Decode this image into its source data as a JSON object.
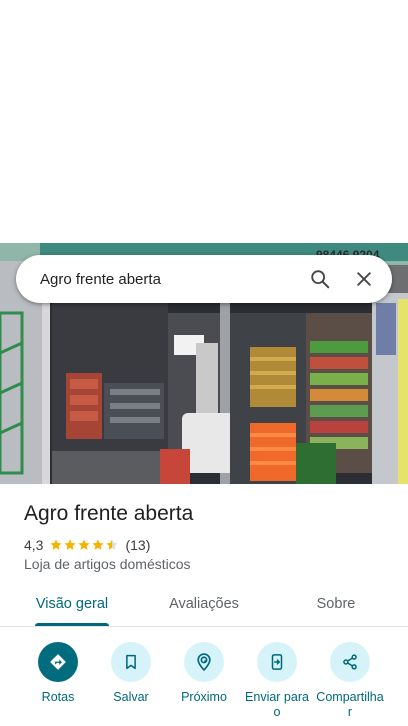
{
  "search": {
    "query": "Agro frente aberta",
    "search_icon": "search-icon",
    "close_icon": "close-icon"
  },
  "place": {
    "title": "Agro frente aberta",
    "rating": "4,3",
    "stars": 4.3,
    "review_count": "(13)",
    "category": "Loja de artigos domésticos"
  },
  "photo_text": {
    "phone": "98446 9204"
  },
  "tabs": [
    {
      "label": "Visão geral",
      "active": true
    },
    {
      "label": "Avaliações",
      "active": false
    },
    {
      "label": "Sobre",
      "active": false
    }
  ],
  "actions": [
    {
      "label": "Rotas",
      "icon": "directions-icon"
    },
    {
      "label": "Salvar",
      "icon": "bookmark-icon"
    },
    {
      "label": "Próximo",
      "icon": "nearby-icon"
    },
    {
      "label": "Enviar para o",
      "icon": "send-to-phone-icon"
    },
    {
      "label": "Compartilha r",
      "icon": "share-icon"
    }
  ],
  "colors": {
    "accent": "#00687a",
    "accent_light": "#d6f3f9",
    "star": "#f4b400"
  }
}
